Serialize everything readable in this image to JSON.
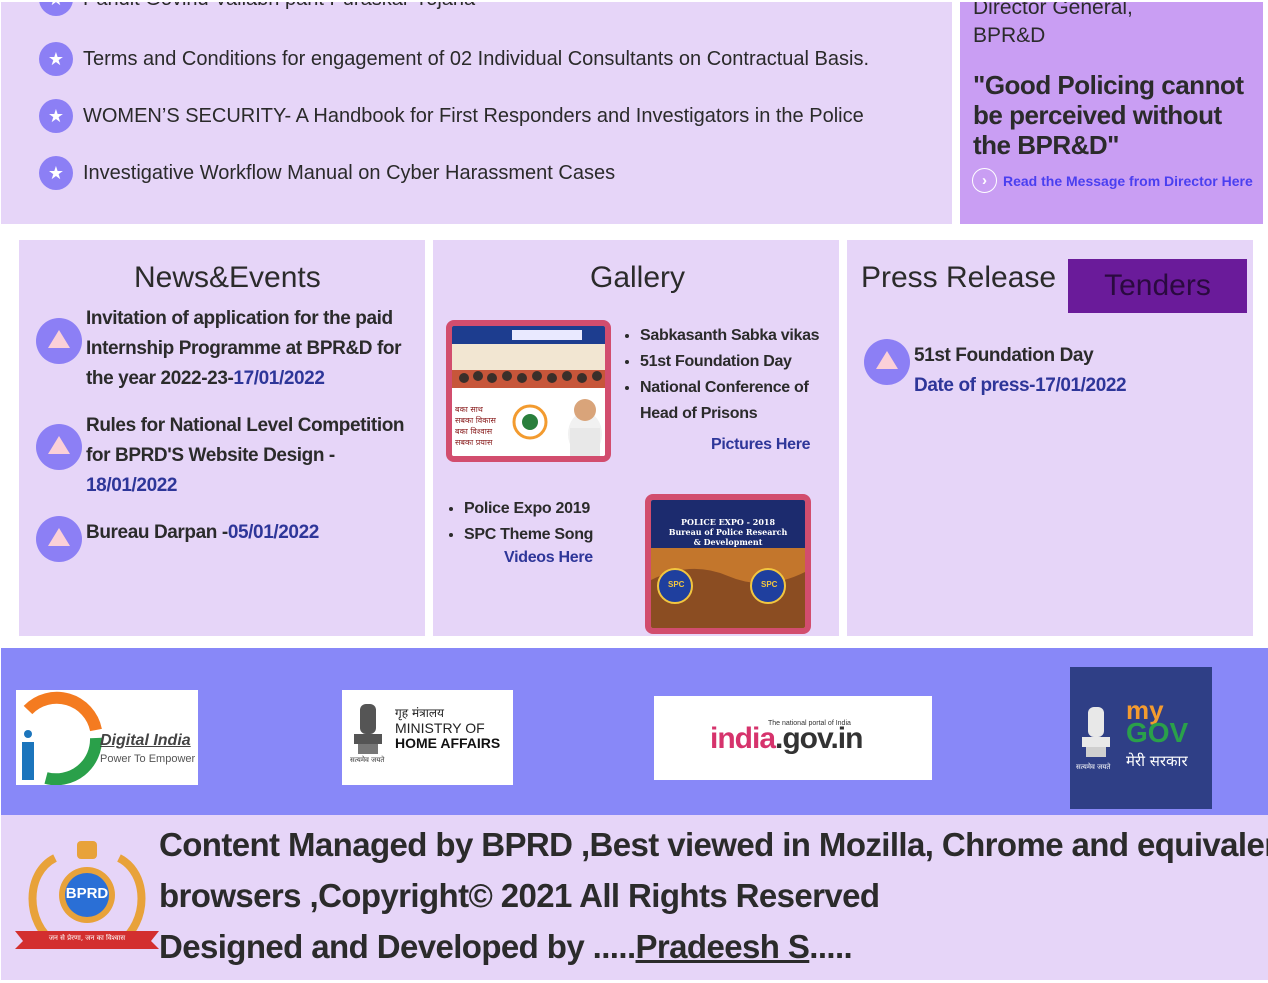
{
  "announcements": {
    "items": [
      {
        "text": "Pandit Govind Vallabh pant Puraskar Yojana"
      },
      {
        "text": "Terms and Conditions for engagement of 02 Individual Consultants on Contractual Basis."
      },
      {
        "text": "WOMEN’S SECURITY- A Handbook for First Responders and Investigators in the Police"
      },
      {
        "text": "Investigative Workflow Manual on Cyber Harassment Cases"
      }
    ],
    "star_icon": "★"
  },
  "director": {
    "role": "Director General,",
    "org": "BPR&D",
    "quote": "\"Good Policing cannot be perceived without the BPR&D\"",
    "link_label": "Read the Message from Director Here",
    "link_icon": "›"
  },
  "news": {
    "title": "News&Events",
    "items": [
      {
        "text": "Invitation of application for the paid Internship Programme at BPR&D for the year 2022-23-",
        "date": "17/01/2022"
      },
      {
        "text": "Rules for National Level Competition for BPRD'S Website Design -",
        "date": "18/01/2022"
      },
      {
        "text": "Bureau Darpan -",
        "date": "05/01/2022"
      }
    ]
  },
  "gallery": {
    "title": "Gallery",
    "photo_items": [
      "Sabkasanth Sabka vikas",
      "51st Foundation Day",
      "National Conference of Head of Prisons"
    ],
    "photo_link": "Pictures Here",
    "photo_slogan": [
      "बका साथ",
      "सबका विकास",
      "बका विश्वास",
      "सबका प्रयास"
    ],
    "video_items": [
      "Police Expo 2019",
      "SPC Theme Song"
    ],
    "video_link": "Videos Here",
    "video_thumb_title": [
      "POLICE EXPO - 2018",
      "Bureau of Police Research",
      "& Development"
    ],
    "badge_text": "SPC"
  },
  "press": {
    "title": "Press Release",
    "tenders_label": "Tenders",
    "items": [
      {
        "title": "51st Foundation Day",
        "date_prefix": "Date of press-",
        "date": "17/01/2022"
      }
    ]
  },
  "logos": {
    "digital_india": {
      "name": "Digital India",
      "tagline": "Power To Empower"
    },
    "mha": {
      "hindi": "गृह मंत्रालय",
      "line1": "MINISTRY OF",
      "line2": "HOME AFFAIRS",
      "motto": "सत्यमेव जयते"
    },
    "india_gov": {
      "small": "The national portal of India",
      "main_a": "india",
      "main_b": ".gov.in"
    },
    "mygov": {
      "my": "my",
      "gov": "GOV",
      "hindi": "मेरी सरकार",
      "motto": "सत्यमेव जयते"
    }
  },
  "footer": {
    "line1": "Content Managed by BPRD ,Best viewed in Mozilla, Chrome and equivalent",
    "line2": "browsers ,Copyright© 2021 All Rights Reserved",
    "line3_prefix": "Designed and Developed by .....",
    "developer": "Pradeesh S",
    "line3_suffix": ".....",
    "emblem_text": "BPRD",
    "ribbon_text": "जन से प्रेरणा, जन का विश्वास"
  },
  "colors": {
    "panel_bg": "#e6d5f8",
    "director_bg": "#c99ef3",
    "badge": "#8c7ff5",
    "logo_band": "#8888f8",
    "date_blue": "#2e3699",
    "tenders_bg": "#6a1b9a"
  }
}
